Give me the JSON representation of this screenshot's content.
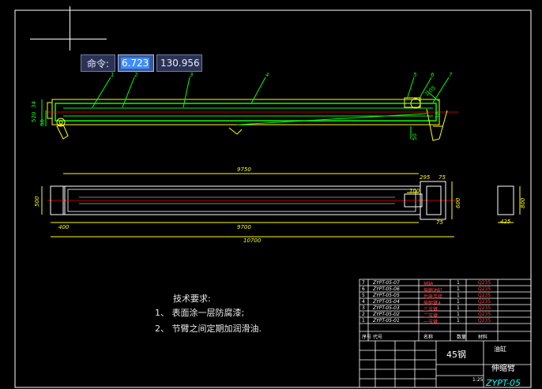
{
  "command_input": {
    "label": "命令:",
    "x_value": "6.723",
    "y_value": "130.956"
  },
  "drawing": {
    "callouts": [
      "1",
      "2",
      "3",
      "4",
      "5",
      "6",
      "7"
    ],
    "side_view": {
      "dim_height_left": "520",
      "dim_height_left2": "30",
      "dim_right_upper": "1.05",
      "dim_right_lower": "50",
      "dim_left_small": "34",
      "dim_right_far": "18"
    },
    "top_view": {
      "dim_overall_top": "9750",
      "dim_width_left": "500",
      "dim_mid": "9700",
      "dim_bottom": "10700",
      "dim_left_small": "400",
      "dim_right_a": "295",
      "dim_right_b": "75",
      "dim_right_c": "100",
      "dim_right_height": "600",
      "dim_right_bottom": "75"
    },
    "section_view": {
      "dim_height": "800",
      "dim_width": "425"
    },
    "technical_requirements": {
      "title": "技术要求:",
      "items": [
        "1、 表面涂一层防腐漆;",
        "2、 节臂之间定期加润滑油."
      ]
    }
  },
  "title_block": {
    "bom": [
      {
        "no": "7",
        "code": "ZYPT-05-07",
        "name": "销轴",
        "qty": "1",
        "mat": "Q235"
      },
      {
        "no": "6",
        "code": "ZYPT-05-06",
        "name": "伸缩油缸",
        "qty": "1",
        "mat": "Q235"
      },
      {
        "no": "5",
        "code": "ZYPT-05-05",
        "name": "后座连接",
        "qty": "1",
        "mat": "Q235"
      },
      {
        "no": "4",
        "code": "ZYPT-05-04",
        "name": "伸缩臂4",
        "qty": "1",
        "mat": "Q235"
      },
      {
        "no": "3",
        "code": "ZYPT-05-03",
        "name": "三节臂",
        "qty": "1",
        "mat": "Q235"
      },
      {
        "no": "2",
        "code": "ZYPT-05-02",
        "name": "二节臂",
        "qty": "1",
        "mat": "Q235"
      },
      {
        "no": "1",
        "code": "ZYPT-05-01",
        "name": "一节臂",
        "qty": "1",
        "mat": "Q235"
      }
    ],
    "header": {
      "no": "序号",
      "code": "代号",
      "name": "名称",
      "qty": "数量",
      "mat": "材料"
    },
    "material": "45钢",
    "company": "油缸",
    "part_name": "伸缩臂",
    "scale": "1:25",
    "drawing_no": "ZYPT-05"
  }
}
